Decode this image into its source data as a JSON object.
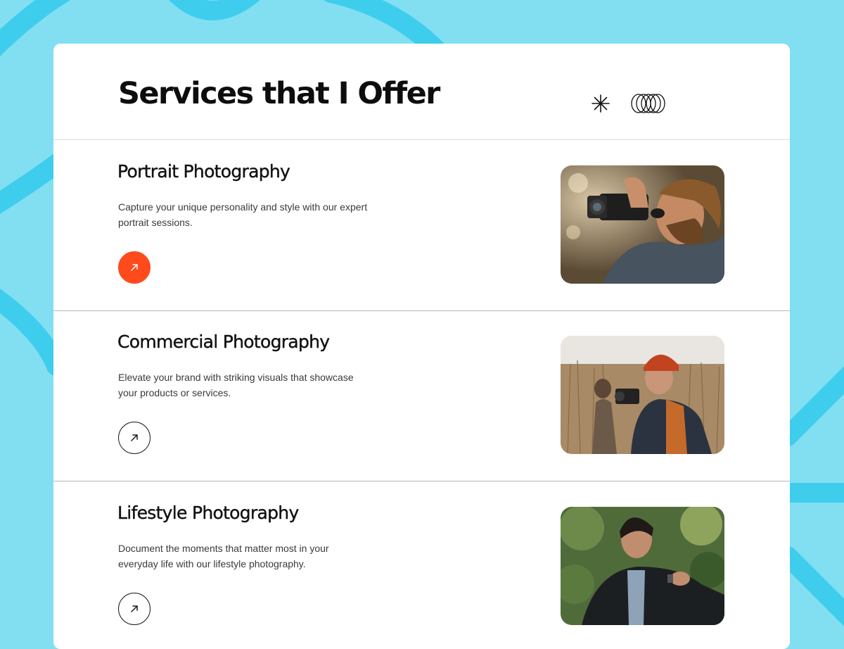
{
  "header": {
    "title": "Services that I Offer",
    "icons": [
      "asterisk-icon",
      "rings-icon"
    ]
  },
  "services": [
    {
      "title": "Portrait Photography",
      "description": "Capture your unique personality and style with our expert portrait sessions.",
      "button": {
        "icon": "arrow-up-right-icon",
        "style": "filled"
      },
      "image": "portrait-photo"
    },
    {
      "title": "Commercial Photography",
      "description": "Elevate your brand with striking visuals that showcase your products or services.",
      "button": {
        "icon": "arrow-up-right-icon",
        "style": "outline"
      },
      "image": "commercial-photo"
    },
    {
      "title": "Lifestyle Photography",
      "description": "Document the moments that matter most in your everyday life with our lifestyle photography.",
      "button": {
        "icon": "arrow-up-right-icon",
        "style": "outline"
      },
      "image": "lifestyle-photo"
    }
  ],
  "colors": {
    "background": "#82dff2",
    "background_stroke": "#3fcdee",
    "card": "#ffffff",
    "accent": "#ff4a1c",
    "text": "#111111"
  }
}
